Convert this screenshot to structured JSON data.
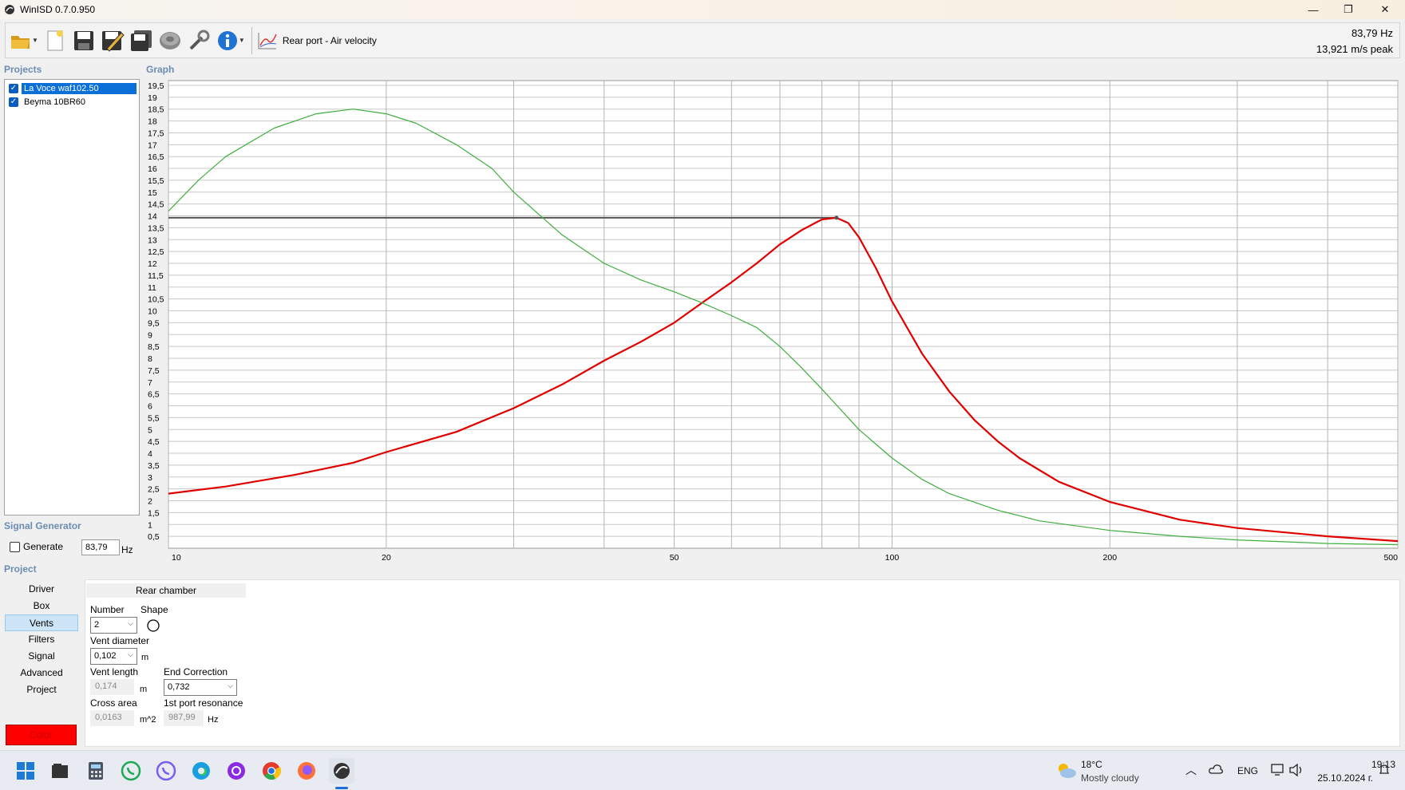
{
  "window": {
    "title": "WinISD 0.7.0.950",
    "controls": {
      "minimize": "—",
      "restore": "❐",
      "close": "✕"
    }
  },
  "toolbar": {
    "buttons": [
      "open-folder-icon",
      "new-project-icon",
      "save-icon",
      "save-as-icon",
      "save-all-icon",
      "driver-editor-icon",
      "tools-icon",
      "info-icon"
    ],
    "graph_type": "Rear port - Air velocity",
    "readout_freq": "83,79 Hz",
    "readout_value": "13,921 m/s peak"
  },
  "labels": {
    "projects": "Projects",
    "graph": "Graph",
    "signal_generator": "Signal Generator",
    "project": "Project"
  },
  "projects": [
    {
      "name": "La Voce waf102.50",
      "checked": true,
      "selected": true
    },
    {
      "name": "Beyma 10BR60",
      "checked": true,
      "selected": false
    }
  ],
  "signal_generator": {
    "generate_label": "Generate",
    "frequency": "83,79",
    "unit": "Hz"
  },
  "project_nav": {
    "items": [
      "Driver",
      "Box",
      "Vents",
      "Filters",
      "Signal",
      "Advanced",
      "Project"
    ],
    "active": "Vents",
    "color_label": "Color",
    "color_value": "#ff0000"
  },
  "vents": {
    "section": "Rear chamber",
    "number_label": "Number",
    "number_value": "2",
    "shape_label": "Shape",
    "diameter_label": "Vent diameter",
    "diameter_value": "0,102",
    "diameter_unit": "m",
    "length_label": "Vent length",
    "length_value": "0,174",
    "length_unit": "m",
    "end_correction_label": "End Correction",
    "end_correction_value": "0,732",
    "cross_area_label": "Cross area",
    "cross_area_value": "0,0163",
    "cross_area_unit": "m^2",
    "resonance_label": "1st port resonance",
    "resonance_value": "987,99",
    "resonance_unit": "Hz"
  },
  "chart_data": {
    "type": "line",
    "title": "",
    "xlabel": "",
    "ylabel": "",
    "xscale": "log",
    "xlim": [
      10,
      500
    ],
    "ylim": [
      0,
      19.7
    ],
    "grid": true,
    "x_tick_labels": [
      "10",
      "20",
      "50",
      "100",
      "200",
      "500"
    ],
    "x_ticks": [
      10,
      20,
      30,
      40,
      50,
      60,
      70,
      80,
      90,
      100,
      200,
      300,
      400,
      500
    ],
    "y_tick_labels": [
      "0,5",
      "1",
      "1,5",
      "2",
      "2,5",
      "3",
      "3,5",
      "4",
      "4,5",
      "5",
      "5,5",
      "6",
      "6,5",
      "7",
      "7,5",
      "8",
      "8,5",
      "9",
      "9,5",
      "10",
      "10,5",
      "11",
      "11,5",
      "12",
      "12,5",
      "13",
      "13,5",
      "14",
      "14,5",
      "15",
      "15,5",
      "16",
      "16,5",
      "17",
      "17,5",
      "18",
      "18,5",
      "19",
      "19,5"
    ],
    "cursor": {
      "x": 83.79,
      "y": 13.921
    },
    "series": [
      {
        "color": "#e00000",
        "points": [
          [
            10,
            2.3
          ],
          [
            12,
            2.6
          ],
          [
            15,
            3.1
          ],
          [
            18,
            3.6
          ],
          [
            20,
            4.05
          ],
          [
            25,
            4.9
          ],
          [
            30,
            5.9
          ],
          [
            35,
            6.9
          ],
          [
            40,
            7.9
          ],
          [
            45,
            8.7
          ],
          [
            50,
            9.5
          ],
          [
            55,
            10.4
          ],
          [
            60,
            11.2
          ],
          [
            65,
            12.0
          ],
          [
            70,
            12.8
          ],
          [
            75,
            13.4
          ],
          [
            80,
            13.85
          ],
          [
            83.79,
            13.92
          ],
          [
            87,
            13.7
          ],
          [
            90,
            13.1
          ],
          [
            95,
            11.8
          ],
          [
            100,
            10.4
          ],
          [
            110,
            8.2
          ],
          [
            120,
            6.6
          ],
          [
            130,
            5.4
          ],
          [
            140,
            4.5
          ],
          [
            150,
            3.8
          ],
          [
            170,
            2.8
          ],
          [
            200,
            1.95
          ],
          [
            250,
            1.2
          ],
          [
            300,
            0.85
          ],
          [
            400,
            0.5
          ],
          [
            500,
            0.3
          ]
        ]
      },
      {
        "color": "#3fae3f",
        "points": [
          [
            10,
            14.2
          ],
          [
            11,
            15.5
          ],
          [
            12,
            16.5
          ],
          [
            14,
            17.7
          ],
          [
            16,
            18.3
          ],
          [
            18,
            18.5
          ],
          [
            20,
            18.3
          ],
          [
            22,
            17.9
          ],
          [
            25,
            17.0
          ],
          [
            28,
            16.0
          ],
          [
            30,
            15.0
          ],
          [
            35,
            13.2
          ],
          [
            40,
            12.0
          ],
          [
            45,
            11.3
          ],
          [
            50,
            10.8
          ],
          [
            55,
            10.3
          ],
          [
            60,
            9.8
          ],
          [
            65,
            9.3
          ],
          [
            70,
            8.5
          ],
          [
            75,
            7.6
          ],
          [
            80,
            6.7
          ],
          [
            90,
            5.0
          ],
          [
            100,
            3.8
          ],
          [
            110,
            2.9
          ],
          [
            120,
            2.3
          ],
          [
            140,
            1.6
          ],
          [
            160,
            1.15
          ],
          [
            200,
            0.75
          ],
          [
            250,
            0.5
          ],
          [
            300,
            0.35
          ],
          [
            400,
            0.2
          ],
          [
            500,
            0.15
          ]
        ]
      }
    ]
  },
  "taskbar": {
    "apps": [
      "windows-start-icon",
      "file-explorer-icon",
      "calculator-icon",
      "whatsapp-icon",
      "viber-icon",
      "edge-icon",
      "podcast-app-icon",
      "chrome-icon",
      "firefox-icon",
      "winisd-icon"
    ],
    "weather_temp": "18°C",
    "weather_desc": "Mostly cloudy",
    "language": "ENG",
    "time": "19:13",
    "date": "25.10.2024 г."
  }
}
